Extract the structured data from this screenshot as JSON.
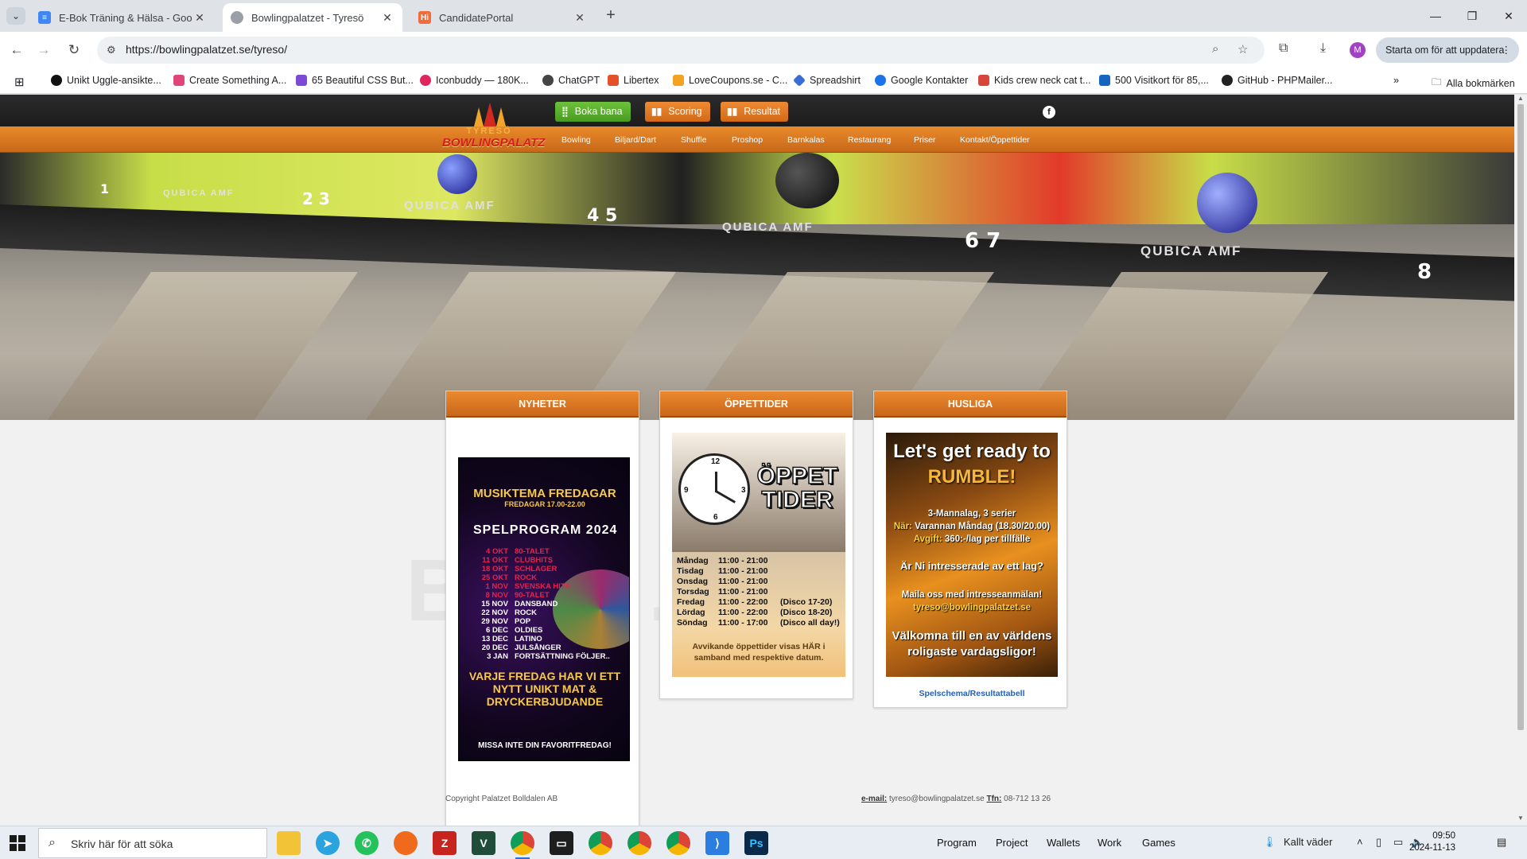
{
  "browser": {
    "tabs": [
      {
        "title": "E-Bok Träning & Hälsa - Google",
        "active": false,
        "fav_color": "#4285f4"
      },
      {
        "title": "Bowlingpalatzet - Tyresö",
        "active": true,
        "fav_color": "#9aa0a6"
      },
      {
        "title": "CandidatePortal",
        "active": false,
        "fav_color": "#f26b3a"
      }
    ],
    "url": "https://bowlingpalatzet.se/tyreso/",
    "update_label": "Starta om för att uppdatera",
    "profile_initial": "M",
    "bookmarks": [
      "Unikt Uggle-ansikte...",
      "Create Something A...",
      "65 Beautiful CSS But...",
      "Iconbuddy — 180K...",
      "ChatGPT",
      "Libertex",
      "LoveCoupons.se - C...",
      "Spreadshirt",
      "Google Kontakter",
      "Kids crew neck cat t...",
      "500 Visitkort för 85,...",
      "GitHub - PHPMailer..."
    ],
    "all_bookmarks_label": "Alla bokmärken"
  },
  "site": {
    "top_buttons": {
      "book": "Boka bana",
      "scoring": "Scoring",
      "results": "Resultat"
    },
    "logo_line1": "TYRESÖ",
    "logo_line2": "BOWLINGPALATZ",
    "nav": [
      "Bowling",
      "Biljard/Dart",
      "Shuffle",
      "Proshop",
      "Barnkalas",
      "Restaurang",
      "Priser",
      "Kontakt/Öppettider"
    ],
    "hero": {
      "lane_numbers": [
        "1",
        "2 3",
        "4 5",
        "6 7",
        "8"
      ],
      "brand": "QUBICA AMF"
    },
    "boxes": {
      "news": {
        "title": "NYHETER",
        "poster": {
          "title": "MUSIKTEMA FREDAGAR",
          "subtitle": "FREDAGAR 17.00-22.00",
          "program": "SPELPROGRAM 2024",
          "rows": [
            {
              "date": "4 OKT",
              "theme": "80-TALET",
              "past": true
            },
            {
              "date": "11 OKT",
              "theme": "CLUBHITS",
              "past": true
            },
            {
              "date": "18 OKT",
              "theme": "SCHLAGER",
              "past": true
            },
            {
              "date": "25 OKT",
              "theme": "ROCK",
              "past": true
            },
            {
              "date": "1 NOV",
              "theme": "SVENSKA HITS",
              "past": true
            },
            {
              "date": "8 NOV",
              "theme": "90-TALET",
              "past": true
            },
            {
              "date": "15 NOV",
              "theme": "DANSBAND",
              "past": false
            },
            {
              "date": "22 NOV",
              "theme": "ROCK",
              "past": false
            },
            {
              "date": "29 NOV",
              "theme": "POP",
              "past": false
            },
            {
              "date": "6 DEC",
              "theme": "OLDIES",
              "past": false
            },
            {
              "date": "13 DEC",
              "theme": "LATINO",
              "past": false
            },
            {
              "date": "20 DEC",
              "theme": "JULSÅNGER",
              "past": false
            },
            {
              "date": "3 JAN",
              "theme": "FORTSÄTTNING FÖLJER..",
              "past": false
            }
          ],
          "footer1": "VARJE FREDAG HAR VI ETT NYTT UNIKT MAT & DRYCKERBJUDANDE",
          "footer2": "MISSA INTE DIN FAVORITFREDAG!"
        }
      },
      "hours": {
        "title": "ÖPPETTIDER",
        "poster": {
          "title_line1": "ÖPPET",
          "title_line2": "TIDER",
          "rows": [
            {
              "day": "Måndag",
              "time": "11:00 - 21:00",
              "note": ""
            },
            {
              "day": "Tisdag",
              "time": "11:00 - 21:00",
              "note": ""
            },
            {
              "day": "Onsdag",
              "time": "11:00 - 21:00",
              "note": ""
            },
            {
              "day": "Torsdag",
              "time": "11:00 - 21:00",
              "note": ""
            },
            {
              "day": "Fredag",
              "time": "11:00 - 22:00",
              "note": "(Disco 17-20)"
            },
            {
              "day": "Lördag",
              "time": "11:00 - 22:00",
              "note": "(Disco 18-20)"
            },
            {
              "day": "Söndag",
              "time": "11:00 - 17:00",
              "note": "(Disco all day!)"
            }
          ],
          "note": "Avvikande öppettider visas HÄR i samband med respektive datum."
        }
      },
      "league": {
        "title": "HUSLIGA",
        "poster": {
          "line1": "Let's get ready to",
          "line2": "RUMBLE!",
          "format": "3-Mannalag, 3 serier",
          "when_label": "När:",
          "when": "Varannan Måndag (18.30/20.00)",
          "fee_label": "Avgift:",
          "fee": "360:-/lag per tillfälle",
          "question": "Är Ni intresserade av ett lag?",
          "mail_prompt": "Maila oss med intresseanmälan!",
          "email": "tyreso@bowlingpalatzet.se",
          "welcome": "Välkomna till en av världens roligaste vardagsligor!"
        },
        "link": "Spelschema/Resultattabell"
      }
    },
    "footer": {
      "copyright": "Copyright Palatzet Bolldalen AB",
      "email_label": "e-mail:",
      "email": "tyreso@bowlingpalatzet.se",
      "phone_label": "Tfn:",
      "phone": "08-712 13 26"
    }
  },
  "taskbar": {
    "search_placeholder": "Skriv här för att söka",
    "groups": [
      "Program",
      "Project",
      "Wallets",
      "Work",
      "Games"
    ],
    "weather": "Kallt väder",
    "time": "09:50",
    "date": "2024-11-13"
  }
}
